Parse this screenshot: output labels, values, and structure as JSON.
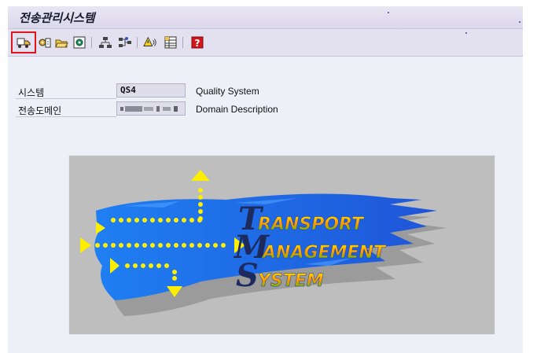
{
  "window": {
    "title": "전송관리시스템"
  },
  "toolbar": {
    "buttons": [
      {
        "icon": "transport-truck-icon",
        "highlighted": true
      },
      {
        "icon": "config-wizard-icon"
      },
      {
        "icon": "open-folder-icon"
      },
      {
        "icon": "overview-icon"
      },
      {
        "icon": "hierarchy-icon"
      },
      {
        "icon": "routes-icon"
      },
      {
        "icon": "alert-monitor-icon"
      },
      {
        "icon": "table-icon"
      },
      {
        "icon": "help-icon"
      }
    ]
  },
  "form": {
    "system_label": "시스템",
    "system_value": "QS4",
    "system_desc": "Quality System",
    "domain_label": "전송도메인",
    "domain_desc": "Domain Description"
  },
  "logo": {
    "line1_cap": "T",
    "line1_rest": "RANSPORT",
    "line2_cap": "M",
    "line2_rest": "ANAGEMENT",
    "line3_cap": "S",
    "line3_rest": "YSTEM"
  },
  "colors": {
    "accent_red": "#e0141c",
    "logo_blue": "#1f6fe0",
    "arrow_yellow": "#ffee00",
    "letter_navy": "#1c2a5e"
  }
}
